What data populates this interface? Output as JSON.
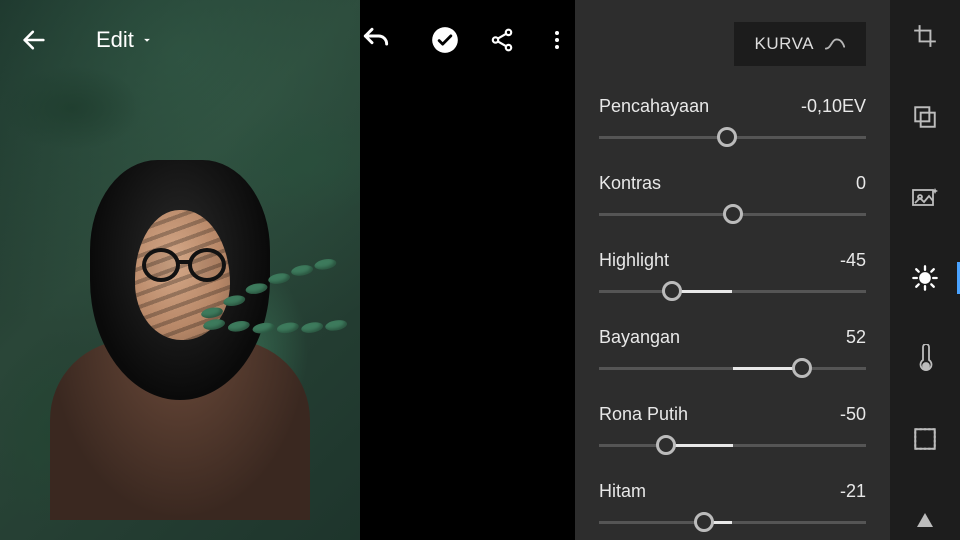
{
  "header": {
    "edit_label": "Edit",
    "icons": {
      "back": "back-arrow-icon",
      "dropdown": "caret-down-icon",
      "undo": "undo-icon",
      "confirm": "check-circle-icon",
      "share": "share-icon",
      "overflow": "more-vert-icon"
    }
  },
  "panel": {
    "curve_button_label": "KURVA",
    "sliders": [
      {
        "label": "Pencahayaan",
        "value_text": "-0,10EV",
        "percent": 48,
        "fill_from": 50,
        "fill_to": 48
      },
      {
        "label": "Kontras",
        "value_text": "0",
        "percent": 50,
        "fill_from": 50,
        "fill_to": 50
      },
      {
        "label": "Highlight",
        "value_text": "-45",
        "percent": 27.5,
        "fill_from": 27.5,
        "fill_to": 50
      },
      {
        "label": "Bayangan",
        "value_text": "52",
        "percent": 76,
        "fill_from": 50,
        "fill_to": 76
      },
      {
        "label": "Rona Putih",
        "value_text": "-50",
        "percent": 25,
        "fill_from": 25,
        "fill_to": 50
      },
      {
        "label": "Hitam",
        "value_text": "-21",
        "percent": 39.5,
        "fill_from": 39.5,
        "fill_to": 50
      }
    ]
  },
  "toolrail": {
    "items": [
      {
        "name": "crop-icon",
        "active": false
      },
      {
        "name": "presets-icon",
        "active": false
      },
      {
        "name": "auto-icon",
        "active": false
      },
      {
        "name": "light-icon",
        "active": true
      },
      {
        "name": "color-temp-icon",
        "active": false
      },
      {
        "name": "vignette-icon",
        "active": false
      },
      {
        "name": "collapse-icon",
        "active": false
      }
    ]
  },
  "colors": {
    "accent": "#4aa3ff",
    "panel_bg": "#2d2d2d",
    "rail_bg": "#1d1d1d"
  }
}
